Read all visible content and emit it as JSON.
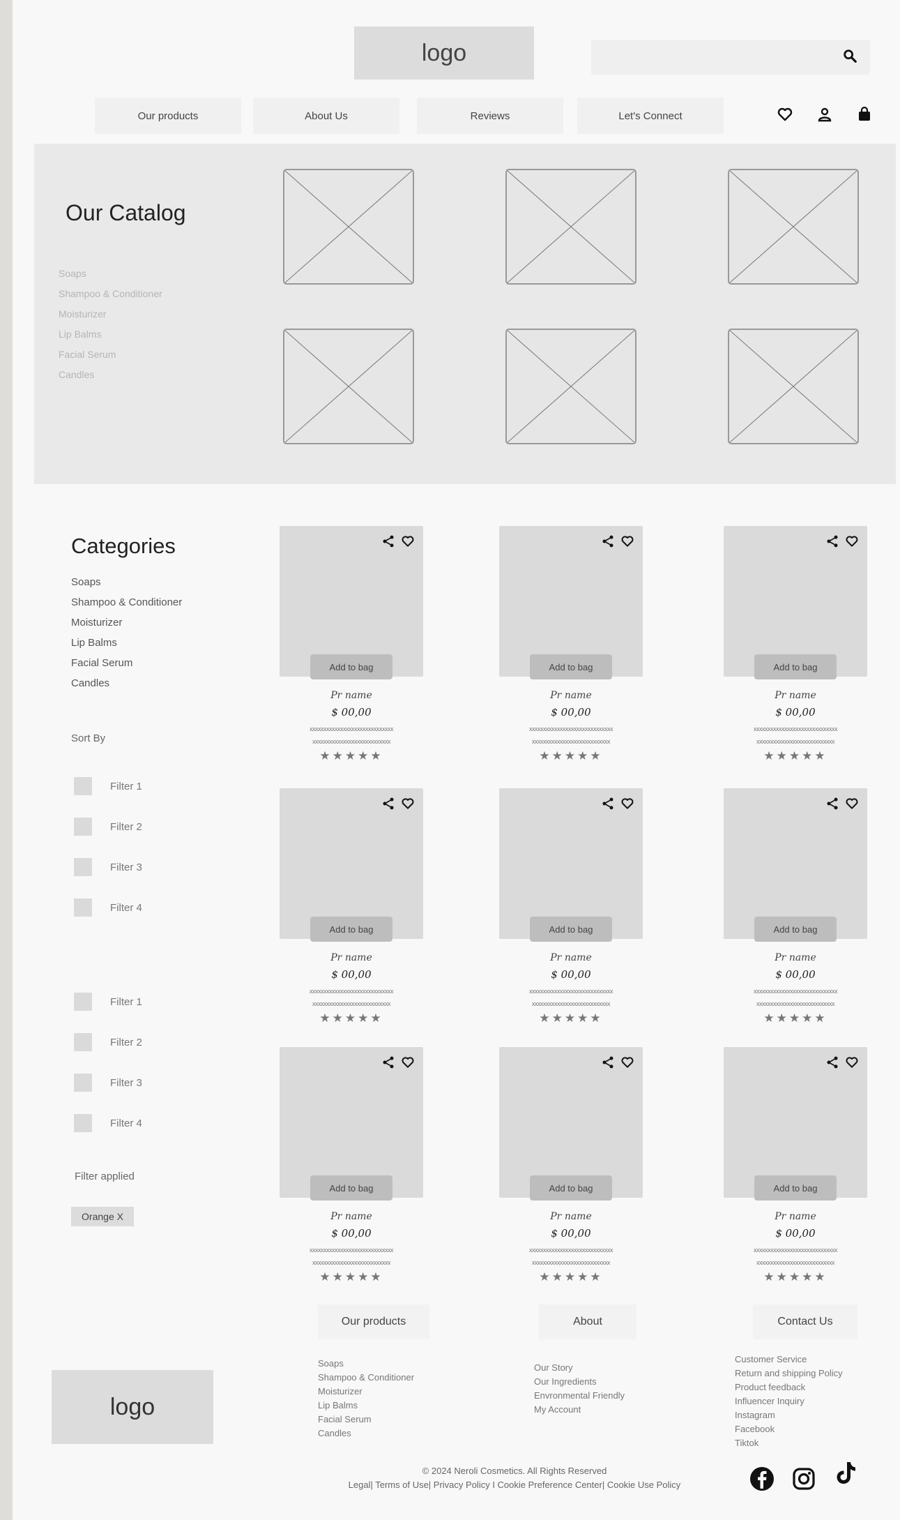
{
  "header": {
    "logo": "logo",
    "nav": [
      "Our products",
      "About Us",
      "Reviews",
      "Let's Connect"
    ]
  },
  "catalog": {
    "title": "Our Catalog",
    "items": [
      "Soaps",
      "Shampoo & Conditioner",
      "Moisturizer",
      "Lip Balms",
      "Facial Serum",
      "Candles"
    ]
  },
  "sidebar": {
    "title": "Categories",
    "items": [
      "Soaps",
      "Shampoo & Conditioner",
      "Moisturizer",
      "Lip Balms",
      "Facial Serum",
      "Candles"
    ],
    "sort_label": "Sort By",
    "filters_a": [
      "Filter 1",
      "Filter 2",
      "Filter 3",
      "Filter 4"
    ],
    "filters_b": [
      "Filter 1",
      "Filter 2",
      "Filter 3",
      "Filter 4"
    ],
    "applied_label": "Filter applied",
    "chip": "Orange X"
  },
  "product": {
    "button": "Add to bag",
    "name": "Pr name",
    "price": "$ 00,00",
    "desc1": "xxxxxxxxxxxxxxxxxxxxxxxxxxxxxx",
    "desc2": "xxxxxxxxxxxxxxxxxxxxxxxxxxxx",
    "stars": "★★★★★",
    "rating": 5
  },
  "footer": {
    "col1": {
      "title": "Our products",
      "items": [
        "Soaps",
        "Shampoo & Conditioner",
        "Moisturizer",
        "Lip Balms",
        "Facial Serum",
        "Candles"
      ]
    },
    "col2": {
      "title": "About",
      "items": [
        "Our Story",
        "Our Ingredients",
        "Envronmental Friendly",
        "My Account"
      ]
    },
    "col3": {
      "title": "Contact Us",
      "items": [
        "Customer Service",
        "Return and shipping Policy",
        "Product feedback",
        "Influencer Inquiry",
        "Instagram",
        "Facebook",
        "Tiktok"
      ]
    },
    "logo": "logo",
    "copyright": "© 2024 Neroli Cosmetics. All Rights Reserved",
    "legal": "Legal| Terms of Use| Privacy Policy I Cookie Preference Center| Cookie Use Policy"
  },
  "icons": {
    "search": "search-icon",
    "heart": "heart-icon",
    "user": "user-icon",
    "bag": "shopping-bag-icon",
    "share": "share-icon",
    "social": [
      "facebook-icon",
      "instagram-icon",
      "tiktok-icon"
    ]
  }
}
